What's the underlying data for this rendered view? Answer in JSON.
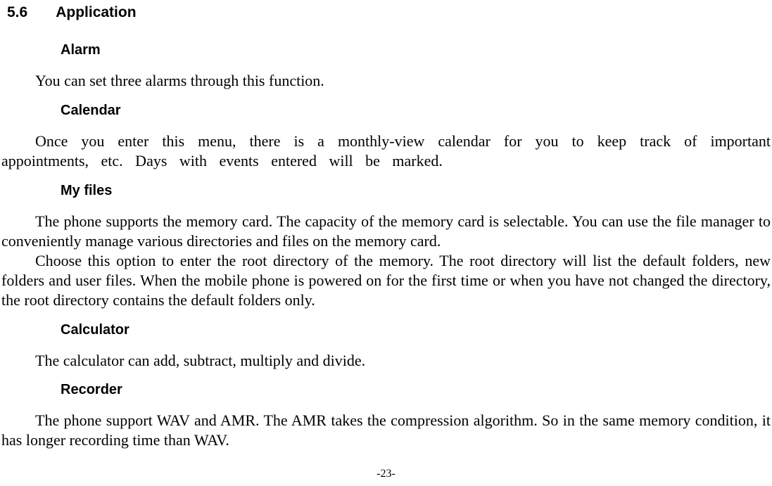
{
  "section": {
    "number": "5.6",
    "title": "Application"
  },
  "subsections": {
    "alarm": {
      "heading": "Alarm",
      "text": "You can set three alarms through this function."
    },
    "calendar": {
      "heading": "Calendar",
      "text": "Once you enter this menu, there is a monthly-view calendar for you to keep track of important appointments, etc. Days with events entered will be marked."
    },
    "myfiles": {
      "heading": "My files",
      "text1": "The phone supports the memory card. The capacity of the memory card is selectable. You can use the file manager to conveniently manage various directories and files on the memory card.",
      "text2": "Choose this option to enter the root directory of the memory. The root directory will list the default folders, new folders and user files. When the mobile phone is powered on for the first time or when you have not changed the directory, the root directory contains the default folders only."
    },
    "calculator": {
      "heading": "Calculator",
      "text": "The calculator can add, subtract, multiply and divide."
    },
    "recorder": {
      "heading": "Recorder",
      "text": "The phone support WAV and AMR. The AMR takes the compression algorithm. So in the same memory condition, it has longer recording time than WAV."
    }
  },
  "pageNumber": "-23-"
}
